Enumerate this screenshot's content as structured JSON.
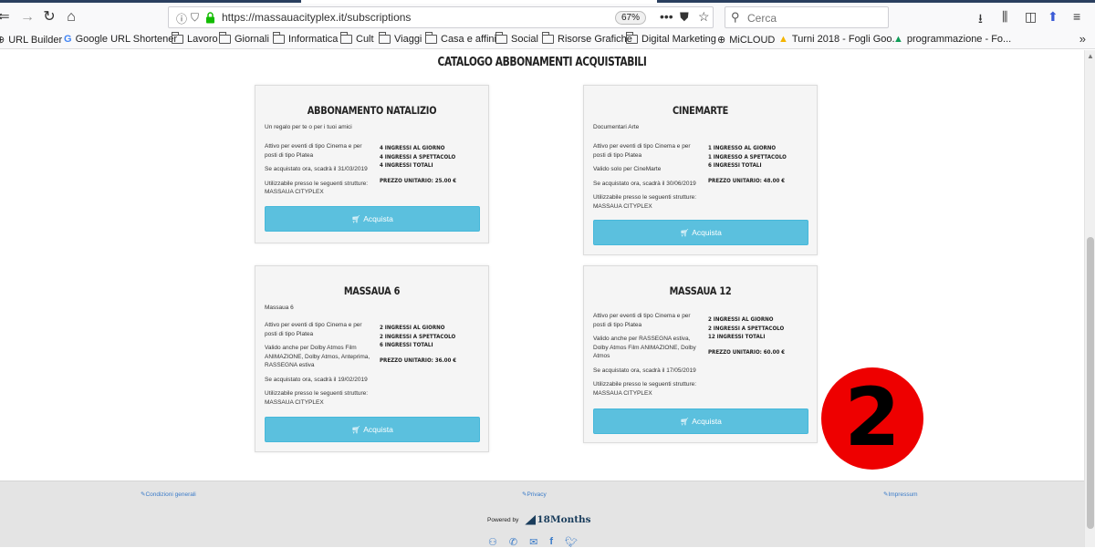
{
  "browser": {
    "url": "https://massauacityplex.it/subscriptions",
    "zoom": "67%",
    "search_placeholder": "Cerca",
    "bookmarks": [
      {
        "label": "URL Builder",
        "icon": "globe-icon"
      },
      {
        "label": "Google URL Shortener",
        "icon": "google-icon"
      },
      {
        "label": "Lavoro",
        "icon": "folder-icon"
      },
      {
        "label": "Giornali",
        "icon": "folder-icon"
      },
      {
        "label": "Informatica",
        "icon": "folder-icon"
      },
      {
        "label": "Cult",
        "icon": "folder-icon"
      },
      {
        "label": "Viaggi",
        "icon": "folder-icon"
      },
      {
        "label": "Casa e affini",
        "icon": "folder-icon"
      },
      {
        "label": "Social",
        "icon": "folder-icon"
      },
      {
        "label": "Risorse Grafiche",
        "icon": "folder-icon"
      },
      {
        "label": "Digital Marketing",
        "icon": "folder-icon"
      },
      {
        "label": "MiCLOUD",
        "icon": "globe-icon"
      },
      {
        "label": "Turni 2018 - Fogli Goo...",
        "icon": "drive-icon"
      },
      {
        "label": "programmazione - Fo...",
        "icon": "drive-icon"
      }
    ]
  },
  "page": {
    "heading": "CATALOGO ABBONAMENTI ACQUISTABILI",
    "buy_label": "Acquista",
    "cards": [
      {
        "title": "ABBONAMENTO NATALIZIO",
        "subtitle": "Un regalo per te o per i tuoi amici",
        "info": [
          "Attivo per eventi di tipo Cinema e per posti di tipo Platea",
          "Se acquistato ora, scadrà il 31/03/2019",
          "Utilizzabile presso le seguenti strutture: MASSAUA CITYPLEX"
        ],
        "limits": [
          "4 INGRESSI AL GIORNO",
          "4 INGRESSI A SPETTACOLO",
          "4 INGRESSI TOTALI"
        ],
        "price": "PREZZO UNITARIO: 25.00 €"
      },
      {
        "title": "CINEMARTE",
        "subtitle": "Documentari Arte",
        "info": [
          "Attivo per eventi di tipo Cinema e per posti di tipo Platea",
          "Valido solo per CineMarte",
          "Se acquistato ora, scadrà il 30/06/2019",
          "Utilizzabile presso le seguenti strutture: MASSAUA CITYPLEX"
        ],
        "limits": [
          "1 INGRESSO AL GIORNO",
          "1 INGRESSO A SPETTACOLO",
          "6 INGRESSI TOTALI"
        ],
        "price": "PREZZO UNITARIO: 48.00 €"
      },
      {
        "title": "MASSAUA 6",
        "subtitle": "Massaua 6",
        "info": [
          "Attivo per eventi di tipo Cinema e per posti di tipo Platea",
          "Valido anche per Dolby Atmos Film ANIMAZIONE, Dolby Atmos, Anteprima, RASSEGNA estiva",
          "Se acquistato ora, scadrà il 19/02/2019",
          "Utilizzabile presso le seguenti strutture: MASSAUA CITYPLEX"
        ],
        "limits": [
          "2 INGRESSI AL GIORNO",
          "2 INGRESSI A SPETTACOLO",
          "6 INGRESSI TOTALI"
        ],
        "price": "PREZZO UNITARIO: 36.00 €"
      },
      {
        "title": "MASSAUA 12",
        "subtitle": "",
        "info": [
          "Attivo per eventi di tipo Cinema e per posti di tipo Platea",
          "Valido anche per RASSEGNA estiva, Dolby Atmos Film ANIMAZIONE, Dolby Atmos",
          "Se acquistato ora, scadrà il 17/05/2019",
          "Utilizzabile presso le seguenti strutture: MASSAUA CITYPLEX"
        ],
        "limits": [
          "2 INGRESSI AL GIORNO",
          "2 INGRESSI A SPETTACOLO",
          "12 INGRESSI TOTALI"
        ],
        "price": "PREZZO UNITARIO: 60.00 €"
      }
    ],
    "annotation": "2",
    "annotation_color": "#ee0000",
    "accent_color": "#5bc0de"
  },
  "footer": {
    "links": [
      "Condizioni generali",
      "Privacy",
      "Impressum"
    ],
    "powered_by": "Powered by",
    "brand": "18Months",
    "social_icons": [
      "phone-icon",
      "call-icon",
      "email-icon",
      "facebook-icon",
      "twitter-icon"
    ]
  }
}
